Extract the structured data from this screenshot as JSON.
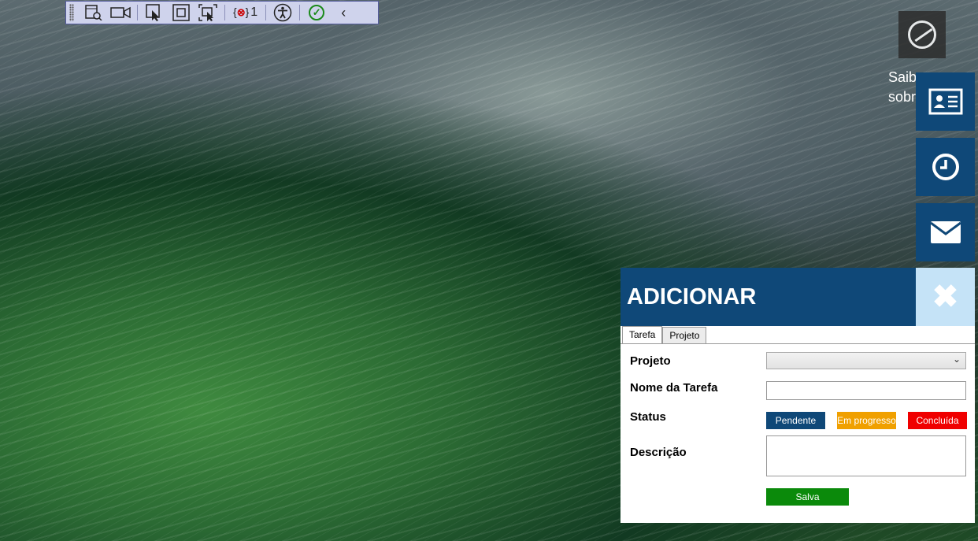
{
  "toolbar": {
    "error_count": "1",
    "icons": [
      "grip-icon",
      "live-visual-tree-icon",
      "record-icon",
      "select-element-icon",
      "display-adorners-icon",
      "track-focus-icon",
      "binding-errors-icon",
      "accessibility-icon",
      "check-icon",
      "collapse-icon"
    ]
  },
  "background": {
    "partial_text_line1": "Saib",
    "partial_text_line2": "sobr"
  },
  "panel": {
    "title": "ADICIONAR",
    "close_glyph": "✖",
    "tabs": [
      {
        "label": "Tarefa",
        "active": true
      },
      {
        "label": "Projeto",
        "active": false
      }
    ],
    "fields": {
      "projeto_label": "Projeto",
      "projeto_value": "",
      "nome_label": "Nome da Tarefa",
      "nome_value": "",
      "status_label": "Status",
      "descricao_label": "Descrição",
      "descricao_value": ""
    },
    "status_options": [
      {
        "label": "Pendente",
        "color": "#0f4878"
      },
      {
        "label": "Em progresso",
        "color": "#f0a000"
      },
      {
        "label": "Concluída",
        "color": "#f00000"
      }
    ],
    "save_label": "Salva",
    "save_color": "#0b8a0b"
  },
  "colors": {
    "accent": "#0f4878",
    "close_bg": "#c5e3f7"
  }
}
